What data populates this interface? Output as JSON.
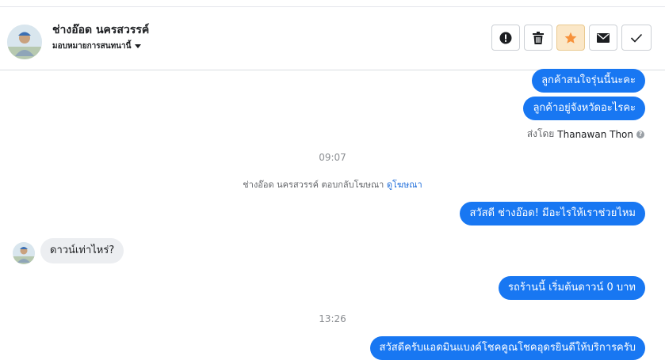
{
  "header": {
    "contact_name": "ช่างอ๊อด นครสวรรค์",
    "assign_label": "มอบหมายการสนทนานี้",
    "actions": [
      "alert-icon",
      "trash-icon",
      "star-icon",
      "envelope-icon",
      "check-icon"
    ],
    "star_color": "#f7923b"
  },
  "messages": {
    "out1": "ลูกค้าสนใจรุ่นนี้นะคะ",
    "out2": "ลูกค้าอยู่จังหวัดอะไรคะ",
    "sent_by_prefix": "ส่งโดย",
    "sent_by_name": "Thanawan Thon",
    "time1": "09:07",
    "sys_text": "ช่างอ๊อด นครสวรรค์ ตอบกลับโฆษณา",
    "sys_link": "ดูโฆษณา",
    "out3": "สวัสดี ช่างอ๊อด! มีอะไรให้เราช่วยไหม",
    "in1": "ดาวน์เท่าไหร่?",
    "out4": "รถร้านนี้ เริ่มต้นดาวน์ 0 บาท",
    "time2": "13:26",
    "out5": "สวัสดีครับแอดมินแบงค์โชคคูณโชคอุดรยินดีให้บริการครับ"
  },
  "colors": {
    "accent": "#1877f2",
    "incoming_bubble": "#eceef1"
  }
}
